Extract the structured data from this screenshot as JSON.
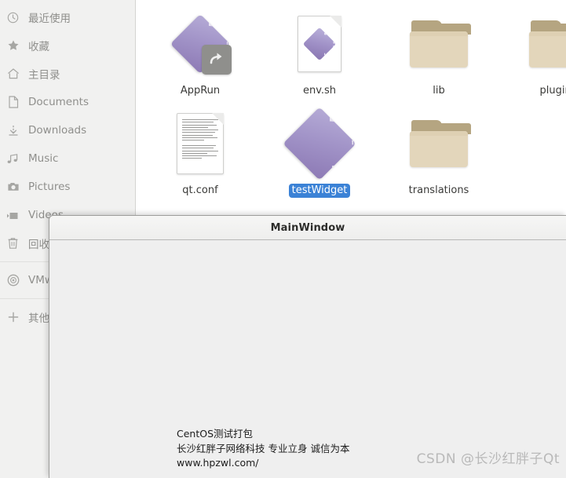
{
  "file_manager": {
    "sidebar": {
      "items": [
        {
          "icon": "clock-icon",
          "label": "最近使用"
        },
        {
          "icon": "star-icon",
          "label": "收藏"
        },
        {
          "icon": "home-icon",
          "label": "主目录"
        },
        {
          "icon": "document-icon",
          "label": "Documents"
        },
        {
          "icon": "download-icon",
          "label": "Downloads"
        },
        {
          "icon": "music-icon",
          "label": "Music"
        },
        {
          "icon": "camera-icon",
          "label": "Pictures"
        },
        {
          "icon": "video-icon",
          "label": "Videos"
        },
        {
          "icon": "trash-icon",
          "label": "回收站"
        },
        {
          "icon": "disc-icon",
          "label": "VMware Tools"
        },
        {
          "icon": "plus-icon",
          "label": "其他位置"
        }
      ]
    },
    "icons": [
      {
        "name": "AppRun",
        "type": "executable-link",
        "selected": false
      },
      {
        "name": "env.sh",
        "type": "script-file",
        "selected": false
      },
      {
        "name": "lib",
        "type": "folder",
        "selected": false
      },
      {
        "name": "plugins",
        "type": "folder",
        "selected": false
      },
      {
        "name": "qt.conf",
        "type": "text-file",
        "selected": false
      },
      {
        "name": "testWidget",
        "type": "executable",
        "selected": true
      },
      {
        "name": "translations",
        "type": "folder",
        "selected": false
      }
    ]
  },
  "main_window": {
    "title": "MainWindow",
    "content_lines": [
      "CentOS测试打包",
      "长沙红胖子网络科技 专业立身 诚信为本",
      "www.hpzwl.com/"
    ]
  },
  "watermark": {
    "text": "CSDN @长沙红胖子Qt"
  },
  "colors": {
    "selection_blue": "#3b82d6",
    "sidebar_bg": "#f1f1f0",
    "window_bg": "#efefef",
    "folder_tan": "#e3d6bb",
    "executable_purple": "#a294c8"
  }
}
